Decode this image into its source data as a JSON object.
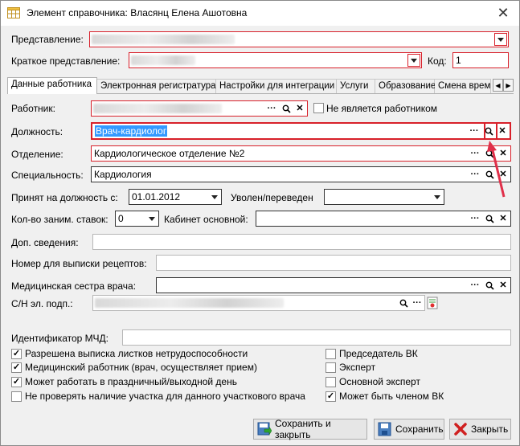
{
  "window": {
    "title": "Элемент справочника: Власянц Елена Ашотовна",
    "close_label": "✕"
  },
  "header": {
    "predstavlenie_label": "Представление:",
    "kratkoe_label": "Краткое представление:",
    "kod_label": "Код:",
    "kod_value": "1"
  },
  "tabs": [
    "Данные работника",
    "Электронная регистратура",
    "Настройки для интеграции",
    "Услуги",
    "Образование",
    "Смена врем"
  ],
  "form": {
    "rabotnik_label": "Работник:",
    "ne_yavlyaetsya_label": "Не является работником",
    "dolzhnost_label": "Должность:",
    "dolzhnost_value": "Врач-кардиолог",
    "otdelenie_label": "Отделение:",
    "otdelenie_value": "Кардиологическое отделение №2",
    "specialnost_label": "Специальность:",
    "specialnost_value": "Кардиология",
    "prinyat_label": "Принят на должность с:",
    "prinyat_value": "01.01.2012",
    "uvolen_label": "Уволен/переведен",
    "stavki_label": "Кол-во заним. ставок:",
    "stavki_value": "0",
    "kabinet_label": "Кабинет основной:",
    "dop_label": "Доп. сведения:",
    "nomer_label": "Номер для выписки рецептов:",
    "sestra_label": "Медицинская сестра врача:",
    "sn_label": "С/Н эл. подп.:",
    "mchd_label": "Идентификатор МЧД:"
  },
  "checkboxes_left": [
    {
      "label": "Разрешена выписка листков нетрудоспособности",
      "checked": true
    },
    {
      "label": "Медицинский работник (врач, осуществляет прием)",
      "checked": true
    },
    {
      "label": "Может работать в праздничный/выходной день",
      "checked": true
    },
    {
      "label": "Не проверять наличие участка для данного участкового врача",
      "checked": false
    }
  ],
  "checkboxes_right": [
    {
      "label": "Председатель ВК",
      "checked": false
    },
    {
      "label": "Эксперт",
      "checked": false
    },
    {
      "label": "Основной эксперт",
      "checked": false
    },
    {
      "label": "Может быть членом ВК",
      "checked": true
    }
  ],
  "buttons": {
    "save_close": "Сохранить и закрыть",
    "save": "Сохранить",
    "close": "Закрыть"
  },
  "icons": {
    "dots": "···",
    "search": "🔍",
    "clear": "✕"
  },
  "colors": {
    "highlight_red": "#d8202a",
    "selection_blue": "#3399ff",
    "arrow": "#e0304a"
  }
}
